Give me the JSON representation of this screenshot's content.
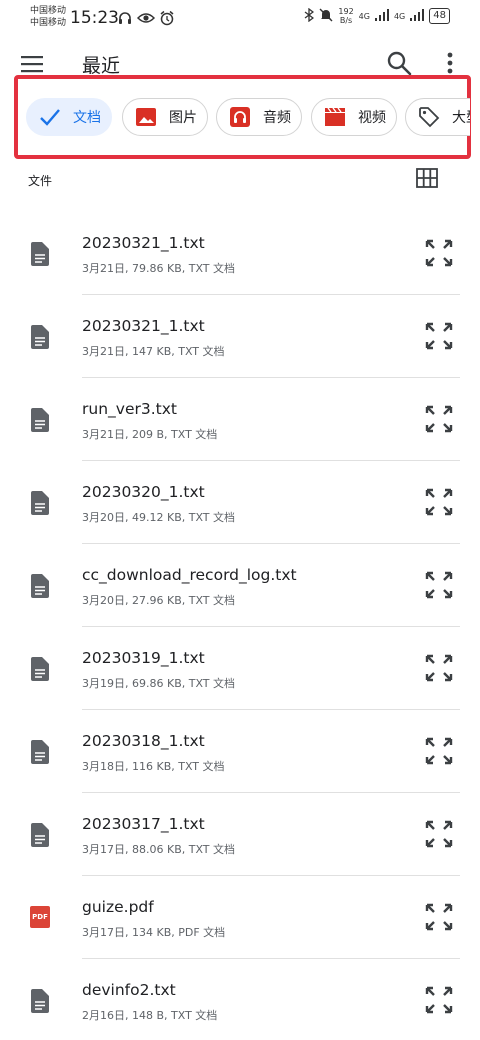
{
  "status_bar": {
    "carrier_1": "中国移动",
    "carrier_2": "中国移动",
    "time": "15:23",
    "net_speed_value": "192",
    "net_speed_unit": "B/s",
    "signal_1": "4G",
    "signal_2": "4G",
    "battery": "48"
  },
  "app_bar": {
    "title": "最近"
  },
  "chips": [
    {
      "label": "文档",
      "icon": "check-icon",
      "active": true
    },
    {
      "label": "图片",
      "icon": "image-icon",
      "active": false
    },
    {
      "label": "音频",
      "icon": "headphones-icon",
      "active": false
    },
    {
      "label": "视频",
      "icon": "clapperboard-icon",
      "active": false
    },
    {
      "label": "大型文件",
      "icon": "tag-icon",
      "active": false
    }
  ],
  "section": {
    "label": "文件"
  },
  "files": [
    {
      "name": "20230321_1.txt",
      "meta": "3月21日, 79.86 KB, TXT 文档",
      "type": "txt"
    },
    {
      "name": "20230321_1.txt",
      "meta": "3月21日, 147 KB, TXT 文档",
      "type": "txt"
    },
    {
      "name": "run_ver3.txt",
      "meta": "3月21日, 209 B, TXT 文档",
      "type": "txt"
    },
    {
      "name": "20230320_1.txt",
      "meta": "3月20日, 49.12 KB, TXT 文档",
      "type": "txt"
    },
    {
      "name": "cc_download_record_log.txt",
      "meta": "3月20日, 27.96 KB, TXT 文档",
      "type": "txt"
    },
    {
      "name": "20230319_1.txt",
      "meta": "3月19日, 69.86 KB, TXT 文档",
      "type": "txt"
    },
    {
      "name": "20230318_1.txt",
      "meta": "3月18日, 116 KB, TXT 文档",
      "type": "txt"
    },
    {
      "name": "20230317_1.txt",
      "meta": "3月17日, 88.06 KB, TXT 文档",
      "type": "txt"
    },
    {
      "name": "guize.pdf",
      "meta": "3月17日, 134 KB, PDF 文档",
      "type": "pdf",
      "badge": "PDF"
    },
    {
      "name": "devinfo2.txt",
      "meta": "2月16日, 148 B, TXT 文档",
      "type": "txt"
    }
  ],
  "colors": {
    "accent": "#1a73e8",
    "highlight_border": "#e3313f",
    "chip_icon_red": "#d93025",
    "pdf_red": "#db4437"
  }
}
